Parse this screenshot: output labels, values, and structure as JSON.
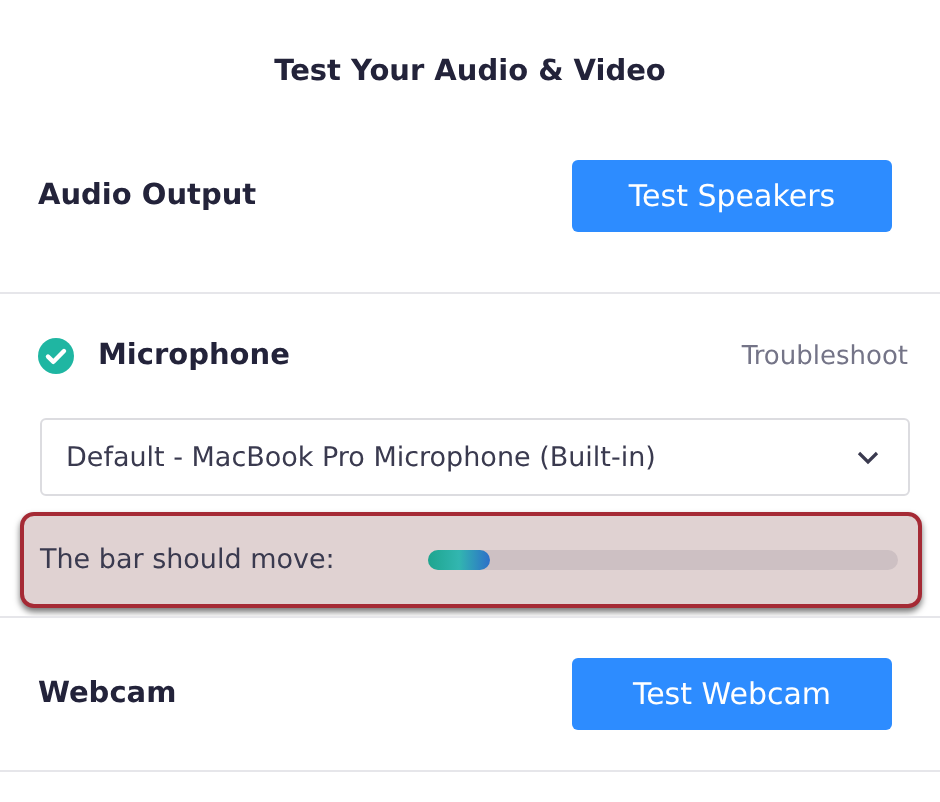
{
  "title": "Test Your Audio & Video",
  "audio_output": {
    "label": "Audio Output",
    "button": "Test Speakers"
  },
  "microphone": {
    "label": "Microphone",
    "checked": true,
    "link": "Troubleshoot",
    "select": {
      "value": "Default - MacBook Pro Microphone (Built-in)"
    },
    "meter": {
      "label": "The bar should move:",
      "level": 0.13,
      "highlighted": true
    }
  },
  "webcam": {
    "label": "Webcam",
    "button": "Test Webcam"
  }
}
